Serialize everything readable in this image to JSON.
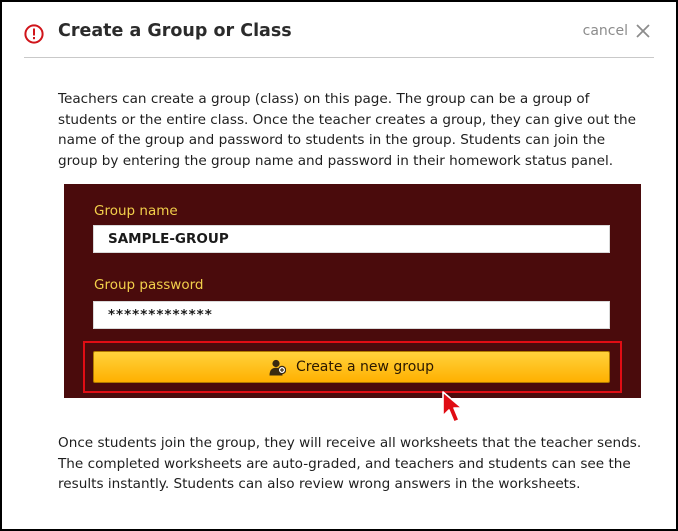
{
  "dialog": {
    "title": "Create a Group or Class",
    "cancel_label": "cancel",
    "intro_text": "Teachers can create a group (class) on this page. The group can be a group of students or the entire class. Once the teacher creates a group, they can give out the name of the group and password to students in the group. Students can join the group by entering the group name and password in their homework status panel.",
    "outro_lines": [
      "Once students join the group, they will receive all worksheets that the teacher sends.",
      "The completed worksheets are auto-graded, and teachers and students can see the results instantly. Students can also review wrong answers in the worksheets."
    ]
  },
  "form": {
    "group_name_label": "Group name",
    "group_name_value": "SAMPLE-GROUP",
    "group_password_label": "Group password",
    "group_password_value": "*************",
    "create_button_label": "Create a new group"
  },
  "icons": {
    "header": "info-circle-icon",
    "close": "close-x-icon",
    "button": "user-add-icon",
    "cursor": "cursor-arrow-icon"
  },
  "colors": {
    "panel_background": "#4a0b0c",
    "label_color": "#f2cf4b",
    "button_gradient_top": "#ffd23c",
    "button_gradient_bottom": "#ffb000",
    "highlight_red": "#e00d14",
    "info_icon_red": "#d0141a"
  }
}
